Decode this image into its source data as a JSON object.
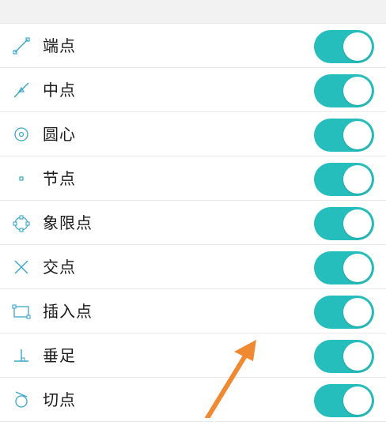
{
  "colors": {
    "toggle_on": "#26bdbd",
    "icon": "#3aa7c8",
    "annotation_arrow": "#f08a32"
  },
  "snap_items": [
    {
      "label": "端点",
      "icon": "endpoint-icon",
      "enabled": true
    },
    {
      "label": "中点",
      "icon": "midpoint-icon",
      "enabled": true
    },
    {
      "label": "圆心",
      "icon": "center-icon",
      "enabled": true
    },
    {
      "label": "节点",
      "icon": "node-icon",
      "enabled": true
    },
    {
      "label": "象限点",
      "icon": "quadrant-icon",
      "enabled": true
    },
    {
      "label": "交点",
      "icon": "intersection-icon",
      "enabled": true
    },
    {
      "label": "插入点",
      "icon": "insertion-icon",
      "enabled": true
    },
    {
      "label": "垂足",
      "icon": "perpendicular-icon",
      "enabled": true
    },
    {
      "label": "切点",
      "icon": "tangent-icon",
      "enabled": true
    }
  ]
}
